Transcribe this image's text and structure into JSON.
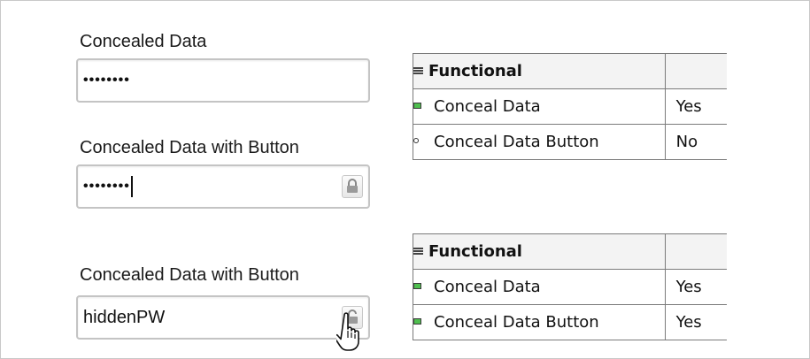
{
  "field1": {
    "label": "Concealed Data",
    "value": "••••••••"
  },
  "field2": {
    "label": "Concealed Data with Button",
    "value": "••••••••"
  },
  "field3": {
    "label": "Concealed Data with Button",
    "value": "hiddenPW"
  },
  "table1": {
    "category": "Functional",
    "rows": [
      {
        "name": "Conceal Data",
        "value": "Yes",
        "marker": "square-green"
      },
      {
        "name": "Conceal Data Button",
        "value": "No",
        "marker": "dot"
      }
    ]
  },
  "table2": {
    "category": "Functional",
    "rows": [
      {
        "name": "Conceal Data",
        "value": "Yes",
        "marker": "square-green"
      },
      {
        "name": "Conceal Data Button",
        "value": "Yes",
        "marker": "square-green"
      }
    ]
  },
  "icons": {
    "lock": "lock-icon",
    "unlock": "unlock-icon",
    "cursor": "hand-pointer-icon",
    "marker_color": "#4fbf4f"
  }
}
